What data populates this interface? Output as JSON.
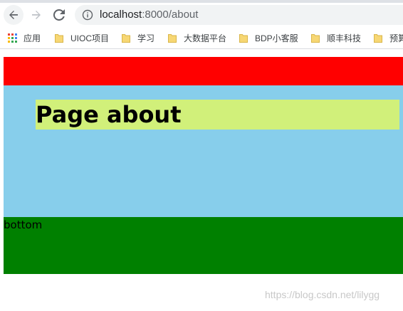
{
  "browser": {
    "url_host": "localhost",
    "url_path": ":8000/about",
    "bookmarks": [
      {
        "label": "应用",
        "icon": "apps-grid-icon"
      },
      {
        "label": "UIOC项目",
        "icon": "folder-icon"
      },
      {
        "label": "学习",
        "icon": "folder-icon"
      },
      {
        "label": "大数据平台",
        "icon": "folder-icon"
      },
      {
        "label": "BDP小客服",
        "icon": "folder-icon"
      },
      {
        "label": "顺丰科技",
        "icon": "folder-icon"
      },
      {
        "label": "预算",
        "icon": "folder-icon"
      }
    ]
  },
  "page": {
    "title": "Page about",
    "footer_text": "bottom"
  },
  "colors": {
    "header_band": "#ff0000",
    "main_band": "#87ceeb",
    "title_box": "#d1f07a",
    "footer_band": "#008000",
    "folder": "#f7d774"
  },
  "watermark": "https://blog.csdn.net/lilygg"
}
